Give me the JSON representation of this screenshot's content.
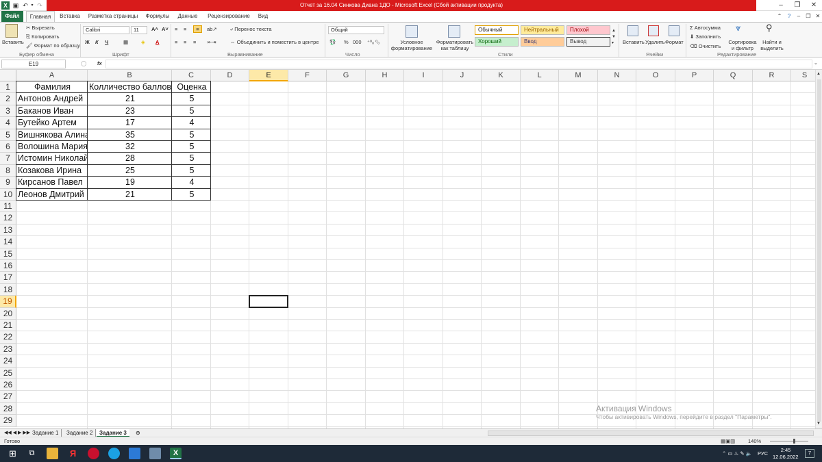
{
  "window": {
    "title": "Отчет за 16.04 Синкова Диана 1ДО  -  Microsoft Excel (Сбой активации продукта)"
  },
  "tabs": [
    "Файл",
    "Главная",
    "Вставка",
    "Разметка страницы",
    "Формулы",
    "Данные",
    "Рецензирование",
    "Вид"
  ],
  "ribbon": {
    "clipboard": {
      "paste": "Вставить",
      "cut": "Вырезать",
      "copy": "Копировать",
      "format_painter": "Формат по образцу",
      "group": "Буфер обмена"
    },
    "font": {
      "name": "Calibri",
      "size": "11",
      "bold": "Ж",
      "italic": "К",
      "underline": "Ч",
      "group": "Шрифт"
    },
    "alignment": {
      "wrap": "Перенос текста",
      "merge": "Объединить и поместить в центре",
      "group": "Выравнивание"
    },
    "number": {
      "format": "Общий",
      "percent": "%",
      "thousands": "000",
      "group": "Число"
    },
    "styles": {
      "conditional": "Условное форматирование",
      "as_table": "Форматировать как таблицу",
      "normal": "Обычный",
      "neutral": "Нейтральный",
      "bad": "Плохой",
      "good": "Хороший",
      "input": "Ввод",
      "output": "Вывод",
      "group": "Стили"
    },
    "cells": {
      "insert": "Вставить",
      "delete": "Удалить",
      "format": "Формат",
      "group": "Ячейки"
    },
    "editing": {
      "autosum": "Автосумма",
      "fill": "Заполнить",
      "clear": "Очистить",
      "sort": "Сортировка и фильтр",
      "find": "Найти и выделить",
      "group": "Редактирование"
    }
  },
  "formula_bar": {
    "name_box": "E19",
    "fx": "fx",
    "value": ""
  },
  "columns": [
    "A",
    "B",
    "C",
    "D",
    "E",
    "F",
    "G",
    "H",
    "I",
    "J",
    "K",
    "L",
    "M",
    "N",
    "O",
    "P",
    "Q",
    "R",
    "S"
  ],
  "rows": [
    "1",
    "2",
    "3",
    "4",
    "5",
    "6",
    "7",
    "8",
    "9",
    "10",
    "11",
    "12",
    "13",
    "14",
    "15",
    "16",
    "17",
    "18",
    "19",
    "20",
    "21",
    "22",
    "23",
    "24",
    "25",
    "26",
    "27",
    "28",
    "29"
  ],
  "table": {
    "headers": [
      "Фамилия",
      "Колличество баллов",
      "Оценка"
    ],
    "data": [
      [
        "Антонов Андрей",
        "21",
        "5"
      ],
      [
        "Баканов Иван",
        "23",
        "5"
      ],
      [
        "Бутейко Артем",
        "17",
        "4"
      ],
      [
        "Вишнякова Алина",
        "35",
        "5"
      ],
      [
        "Волошина Мария",
        "32",
        "5"
      ],
      [
        "Истомин Николай",
        "28",
        "5"
      ],
      [
        "Козакова Ирина",
        "25",
        "5"
      ],
      [
        "Кирсанов Павел",
        "19",
        "4"
      ],
      [
        "Леонов Дмитрий",
        "21",
        "5"
      ]
    ]
  },
  "sheets": [
    "Задание 1",
    "Задание 2",
    "Задание 3"
  ],
  "active_sheet": "Задание 3",
  "status": {
    "ready": "Готово",
    "zoom": "140%"
  },
  "watermark": {
    "title": "Активация Windows",
    "subtitle": "Чтобы активировать Windows, перейдите в раздел \"Параметры\"."
  },
  "taskbar": {
    "lang": "РУС",
    "time": "2:45",
    "date": "12.06.2022",
    "notif": "7"
  },
  "colors": {
    "excel_green": "#217346",
    "title_red": "#d81b1b",
    "selection": "#f3a600"
  }
}
